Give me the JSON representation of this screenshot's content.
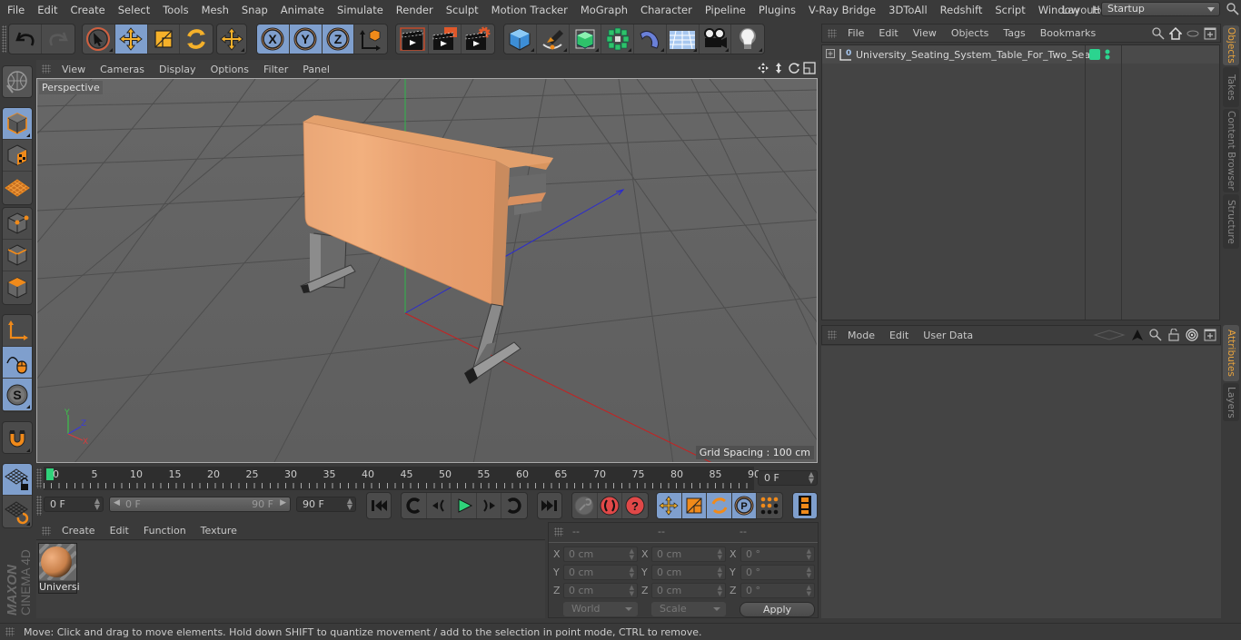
{
  "menubar": {
    "items": [
      "File",
      "Edit",
      "Create",
      "Select",
      "Tools",
      "Mesh",
      "Snap",
      "Animate",
      "Simulate",
      "Render",
      "Sculpt",
      "Motion Tracker",
      "MoGraph",
      "Character",
      "Pipeline",
      "Plugins",
      "V-Ray Bridge",
      "3DToAll",
      "Redshift",
      "Script",
      "Window",
      "Help"
    ],
    "layout_label": "Layout:",
    "layout_value": "Startup"
  },
  "toolbar": {
    "groups": [
      [
        "undo-icon",
        "redo-icon"
      ],
      [
        "live-selection-icon",
        "move-icon",
        "scale-icon",
        "rotate-icon"
      ],
      [
        "last-tool-icon"
      ],
      [
        "x-axis-icon",
        "y-axis-icon",
        "z-axis-icon",
        "coordinate-system-icon"
      ],
      [
        "render-view-icon",
        "render-to-picture-viewer-icon",
        "render-settings-icon"
      ],
      [
        "cube-icon",
        "pen-icon",
        "subdivision-icon",
        "cloner-icon",
        "deformer-icon",
        "floor-icon",
        "camera-icon",
        "light-icon"
      ]
    ]
  },
  "left_toolbar": {
    "items": [
      "make-editable-icon",
      "model-mode-icon",
      "texture-mode-icon",
      "workplane-icon",
      "points-mode-icon",
      "edges-mode-icon",
      "polygons-mode-icon",
      "axis-mode-icon",
      "tweak-mode-icon",
      "solo-icon",
      "snap-icon",
      "lock-workplane-icon",
      "planar-workplane-icon"
    ]
  },
  "viewport": {
    "menu": [
      "View",
      "Cameras",
      "Display",
      "Options",
      "Filter",
      "Panel"
    ],
    "camera_label": "Perspective",
    "grid_spacing": "Grid Spacing : 100 cm",
    "axis_labels": {
      "x": "X",
      "y": "Y",
      "z": "Z"
    }
  },
  "timeline": {
    "ticks": [
      "0",
      "5",
      "10",
      "15",
      "20",
      "25",
      "30",
      "35",
      "40",
      "45",
      "50",
      "55",
      "60",
      "65",
      "70",
      "75",
      "80",
      "85",
      "90"
    ],
    "current_frame": "0 F",
    "start_frame": "0 F",
    "range_start": "0 F",
    "range_end": "90 F",
    "end_frame": "90 F"
  },
  "materials": {
    "menu": [
      "Create",
      "Edit",
      "Function",
      "Texture"
    ],
    "items": [
      {
        "name": "Universi"
      }
    ]
  },
  "coordinates": {
    "headers": [
      "--",
      "--",
      "--"
    ],
    "rows": [
      {
        "axis": "X",
        "pos": "0 cm",
        "size": "0 cm",
        "rot": "0 °"
      },
      {
        "axis": "Y",
        "pos": "0 cm",
        "size": "0 cm",
        "rot": "0 °"
      },
      {
        "axis": "Z",
        "pos": "0 cm",
        "size": "0 cm",
        "rot": "0 °"
      }
    ],
    "space": "World",
    "mode": "Scale",
    "apply": "Apply"
  },
  "objects_panel": {
    "menu": [
      "File",
      "Edit",
      "View",
      "Objects",
      "Tags",
      "Bookmarks"
    ],
    "objects": [
      {
        "name": "University_Seating_System_Table_For_Two_Seats",
        "layer_color": "#2bd48f"
      }
    ]
  },
  "attributes_panel": {
    "menu": [
      "Mode",
      "Edit",
      "User Data"
    ]
  },
  "side_tabs_top": [
    "Objects",
    "Takes",
    "Content Browser",
    "Structure"
  ],
  "side_tabs_bottom": [
    "Attributes",
    "Layers"
  ],
  "status": "Move: Click and drag to move elements. Hold down SHIFT to quantize movement / add to the selection in point mode, CTRL to remove.",
  "logo": {
    "brand": "MAXON",
    "product": "CINEMA 4D"
  },
  "colors": {
    "accent": "#7f9fcd",
    "orange": "#f0a030",
    "tab_active": "#e8a33d",
    "play": "#2fd27a"
  }
}
